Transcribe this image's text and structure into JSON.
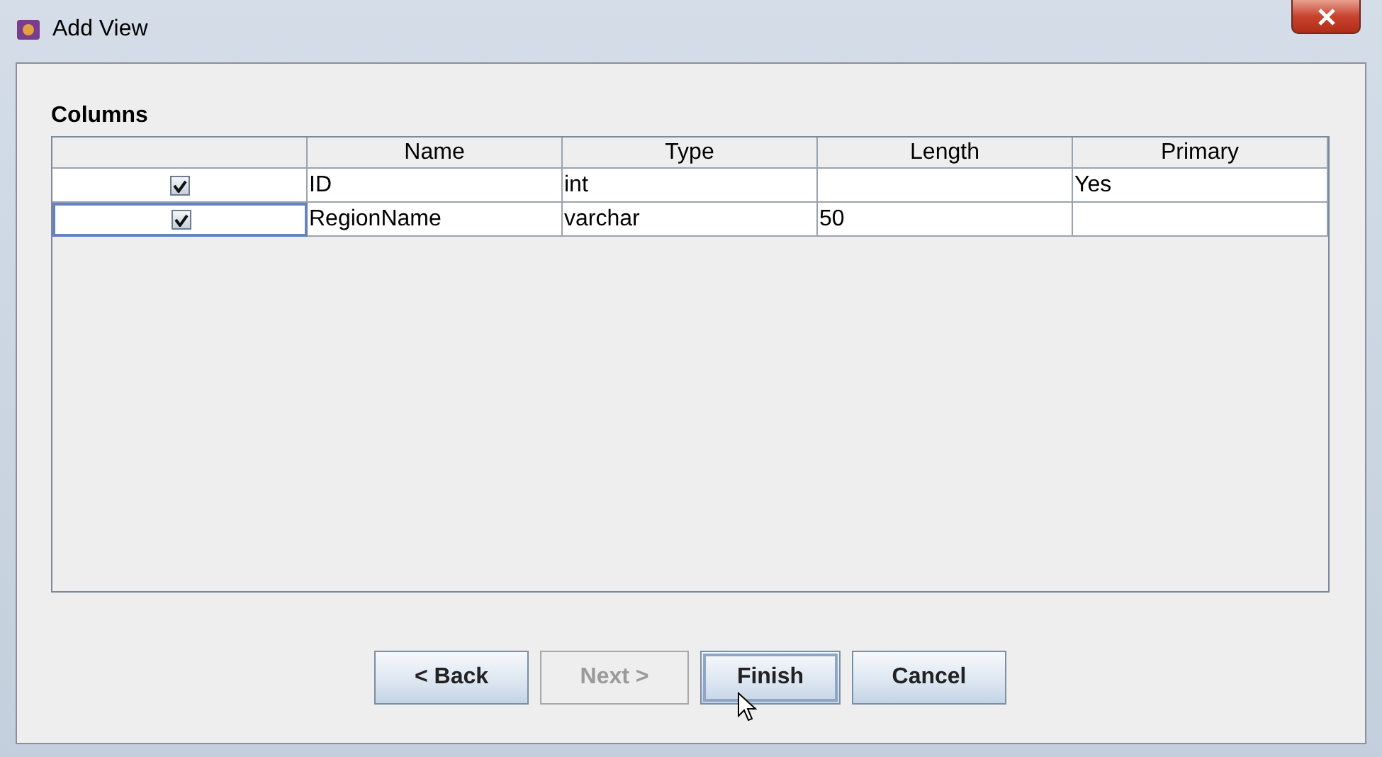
{
  "window": {
    "title": "Add View"
  },
  "section_title": "Columns",
  "table": {
    "columns": [
      "Name",
      "Type",
      "Length",
      "Primary"
    ],
    "rows": [
      {
        "checked": true,
        "selected": false,
        "cells": [
          "ID",
          "int",
          "",
          "Yes"
        ]
      },
      {
        "checked": true,
        "selected": true,
        "cells": [
          "RegionName",
          "varchar",
          "50",
          ""
        ]
      }
    ]
  },
  "buttons": [
    {
      "label": "< Back",
      "disabled": false,
      "focused": false
    },
    {
      "label": "Next >",
      "disabled": true,
      "focused": false
    },
    {
      "label": "Finish",
      "disabled": false,
      "focused": true
    },
    {
      "label": "Cancel",
      "disabled": false,
      "focused": false
    }
  ]
}
